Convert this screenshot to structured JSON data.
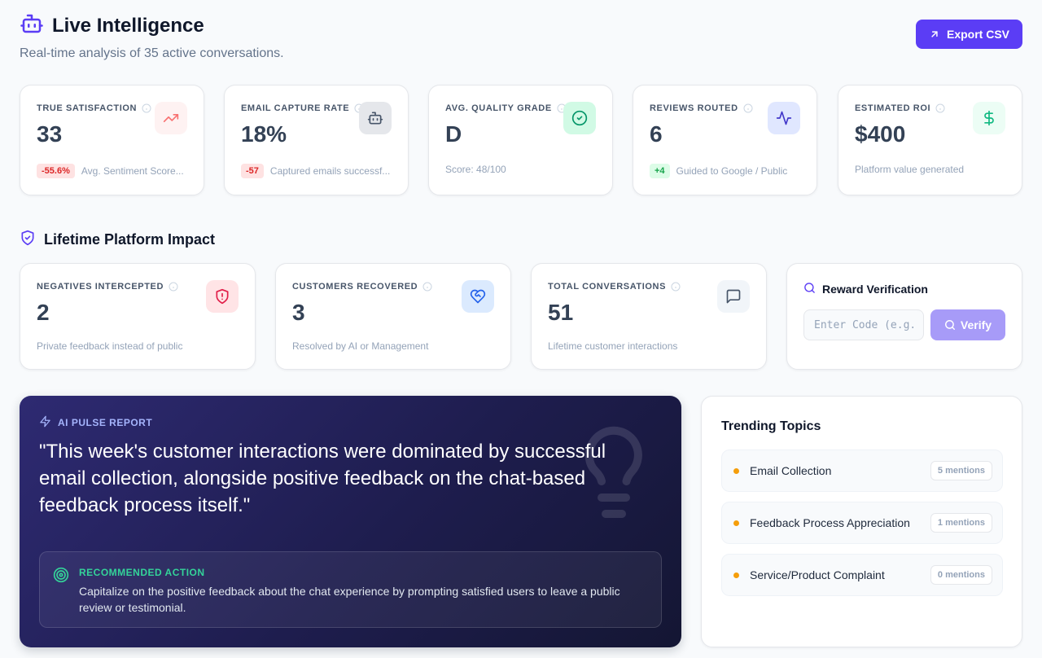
{
  "header": {
    "title": "Live Intelligence",
    "subtitle": "Real-time analysis of 35 active conversations.",
    "export_label": "Export CSV"
  },
  "kpis": [
    {
      "label": "TRUE SATISFACTION",
      "value": "33",
      "badge": "-55.6%",
      "badge_type": "negative",
      "foot": "Avg. Sentiment Score...",
      "icon": "trend-up-icon",
      "icon_color": "#f87171",
      "icon_bg": "#fef2f2"
    },
    {
      "label": "EMAIL CAPTURE RATE",
      "value": "18%",
      "badge": "-57",
      "badge_type": "negative",
      "foot": "Captured emails successf...",
      "icon": "bot-icon",
      "icon_color": "#475569",
      "icon_bg": "#e5e7eb"
    },
    {
      "label": "AVG. QUALITY GRADE",
      "value": "D",
      "foot": "Score: 48/100",
      "icon": "check-circle-icon",
      "icon_color": "#059669",
      "icon_bg": "#d1fae5"
    },
    {
      "label": "REVIEWS ROUTED",
      "value": "6",
      "badge": "+4",
      "badge_type": "positive",
      "foot": "Guided to Google / Public",
      "icon": "activity-icon",
      "icon_color": "#4338ca",
      "icon_bg": "#e0e7ff"
    },
    {
      "label": "ESTIMATED ROI",
      "value": "$400",
      "foot": "Platform value generated",
      "icon": "dollar-icon",
      "icon_color": "#10b981",
      "icon_bg": "#ecfdf5"
    }
  ],
  "lifetime": {
    "title": "Lifetime Platform Impact",
    "cards": [
      {
        "label": "NEGATIVES INTERCEPTED",
        "value": "2",
        "foot": "Private feedback instead of public",
        "icon": "shield-alert-icon",
        "icon_color": "#e11d48",
        "icon_bg": "#ffe4e6"
      },
      {
        "label": "CUSTOMERS RECOVERED",
        "value": "3",
        "foot": "Resolved by AI or Management",
        "icon": "heart-handshake-icon",
        "icon_color": "#2563eb",
        "icon_bg": "#dbeafe"
      },
      {
        "label": "TOTAL CONVERSATIONS",
        "value": "51",
        "foot": "Lifetime customer interactions",
        "icon": "message-square-icon",
        "icon_color": "#475569",
        "icon_bg": "#f1f5f9"
      }
    ]
  },
  "verify": {
    "title": "Reward Verification",
    "placeholder": "Enter Code (e.g.",
    "button_label": "Verify"
  },
  "pulse": {
    "label": "AI PULSE REPORT",
    "quote": "\"This week's customer interactions were dominated by successful email collection, alongside positive feedback on the chat-based feedback process itself.\"",
    "rec_label": "RECOMMENDED ACTION",
    "rec_text": "Capitalize on the positive feedback about the chat experience by prompting satisfied users to leave a public review or testimonial."
  },
  "trending": {
    "title": "Trending Topics",
    "topics": [
      {
        "name": "Email Collection",
        "count": "5 mentions"
      },
      {
        "name": "Feedback Process Appreciation",
        "count": "1 mentions"
      },
      {
        "name": "Service/Product Complaint",
        "count": "0 mentions"
      }
    ]
  },
  "colors": {
    "accent": "#5b3df5",
    "pulse_bg": "#1e1d4e",
    "topic_dot": "#f59e0b",
    "positive": "#16a34a",
    "negative": "#dc2626"
  }
}
